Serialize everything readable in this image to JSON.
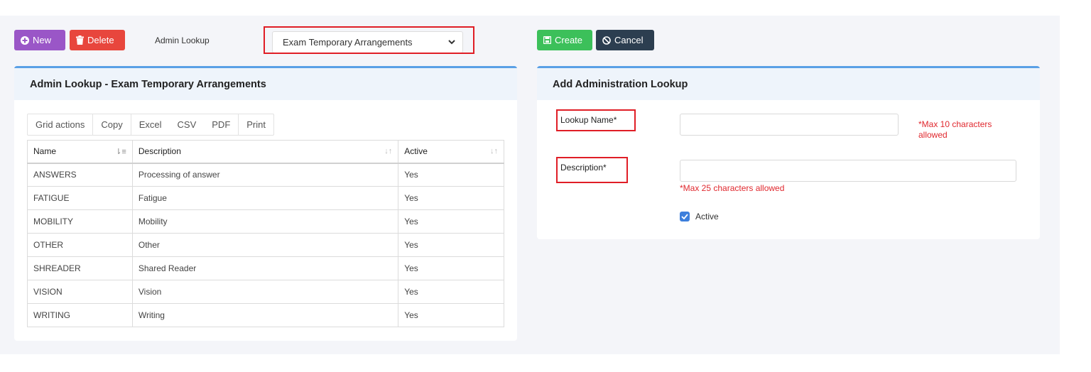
{
  "toolbar": {
    "new_label": "New",
    "delete_label": "Delete",
    "admin_lookup_label": "Admin Lookup",
    "lookup_select_value": "Exam Temporary Arrangements",
    "create_label": "Create",
    "cancel_label": "Cancel"
  },
  "left_panel": {
    "title": "Admin Lookup - Exam Temporary Arrangements",
    "grid_actions": {
      "label": "Grid actions",
      "items": [
        "Copy",
        "Excel",
        "CSV",
        "PDF",
        "Print"
      ]
    },
    "table": {
      "headers": [
        "Name",
        "Description",
        "Active"
      ],
      "rows": [
        [
          "ANSWERS",
          "Processing of answer",
          "Yes"
        ],
        [
          "FATIGUE",
          "Fatigue",
          "Yes"
        ],
        [
          "MOBILITY",
          "Mobility",
          "Yes"
        ],
        [
          "OTHER",
          "Other",
          "Yes"
        ],
        [
          "SHREADER",
          "Shared Reader",
          "Yes"
        ],
        [
          "VISION",
          "Vision",
          "Yes"
        ],
        [
          "WRITING",
          "Writing",
          "Yes"
        ]
      ]
    }
  },
  "right_panel": {
    "title": "Add Administration Lookup",
    "lookup_name_label": "Lookup Name*",
    "lookup_name_value": "",
    "lookup_name_hint_line1": "*Max 10 characters",
    "lookup_name_hint_line2": "allowed",
    "description_label": "Description*",
    "description_value": "",
    "description_hint": "*Max 25 characters allowed",
    "active_label": "Active",
    "active_checked": true
  },
  "colors": {
    "new": "#9a56c7",
    "delete": "#e8463d",
    "create": "#3cc05a",
    "cancel": "#2c3e50",
    "highlight": "#e01e26",
    "panel_accent": "#5aa0e6"
  }
}
